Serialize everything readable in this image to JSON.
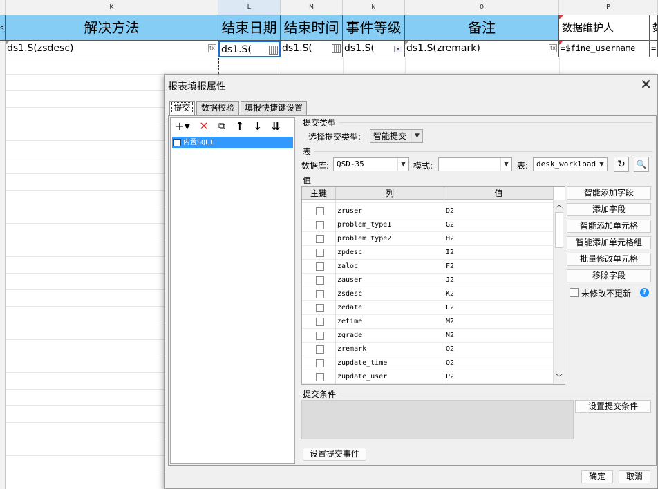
{
  "sheet": {
    "columns": [
      "K",
      "L",
      "M",
      "N",
      "O",
      "P"
    ],
    "headers": [
      "解决方法",
      "结束日期",
      "结束时间",
      "事件等级",
      "备注",
      "数据维护人",
      "数"
    ],
    "cells": [
      "ds1.S(zsdesc)",
      "ds1.S(",
      "ds1.S(",
      "ds1.S(",
      "ds1.S(zremark)",
      "=$fine_username",
      "="
    ],
    "left_edge_char": "s)"
  },
  "dialog": {
    "title": "报表填报属性",
    "close_glyph": "✕",
    "tabs": [
      "提交",
      "数据校验",
      "填报快捷键设置"
    ],
    "tree": {
      "toolbar": [
        "+▾",
        "✕",
        "⧉",
        "↑",
        "↓",
        "⇊"
      ],
      "item": "内置SQL1"
    },
    "submit_type": {
      "section": "提交类型",
      "label": "选择提交类型:",
      "value": "智能提交"
    },
    "table": {
      "section": "表",
      "db_label": "数据库:",
      "db_value": "QSD-35",
      "mode_label": "模式:",
      "mode_value": "",
      "table_label": "表:",
      "table_value": "desk_workload"
    },
    "values": {
      "section": "值",
      "headers": [
        "主键",
        "列",
        "值"
      ],
      "rows": [
        {
          "col": "zruser",
          "val": "D2"
        },
        {
          "col": "problem_type1",
          "val": "G2"
        },
        {
          "col": "problem_type2",
          "val": "H2"
        },
        {
          "col": "zpdesc",
          "val": "I2"
        },
        {
          "col": "zaloc",
          "val": "F2"
        },
        {
          "col": "zauser",
          "val": "J2"
        },
        {
          "col": "zsdesc",
          "val": "K2"
        },
        {
          "col": "zedate",
          "val": "L2"
        },
        {
          "col": "zetime",
          "val": "M2"
        },
        {
          "col": "zgrade",
          "val": "N2"
        },
        {
          "col": "zremark",
          "val": "O2"
        },
        {
          "col": "zupdate_time",
          "val": "Q2"
        },
        {
          "col": "zupdate_user",
          "val": "P2"
        }
      ]
    },
    "side_buttons": [
      "智能添加字段",
      "添加字段",
      "智能添加单元格",
      "智能添加单元格组",
      "批量修改单元格",
      "移除字段"
    ],
    "checkbox_label": "未修改不更新",
    "help_glyph": "?",
    "condition": {
      "section": "提交条件",
      "button": "设置提交条件"
    },
    "event_button": "设置提交事件",
    "ok": "确定",
    "cancel": "取消"
  }
}
